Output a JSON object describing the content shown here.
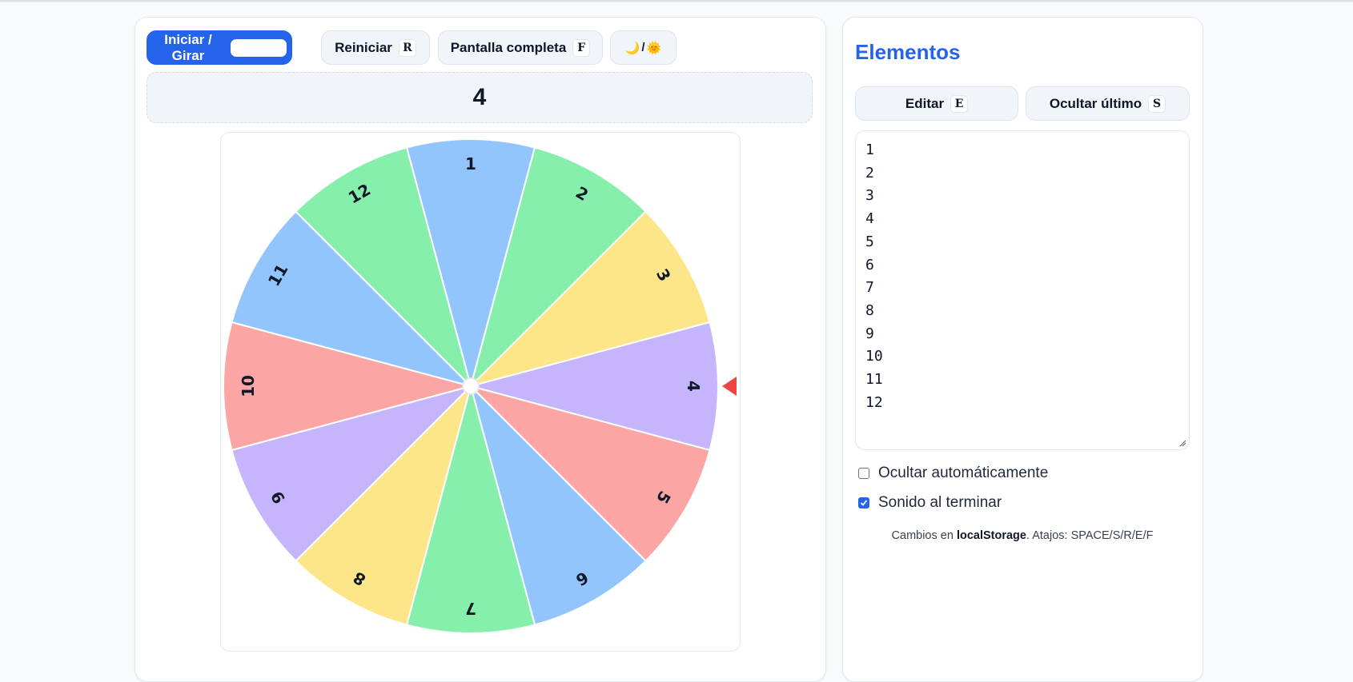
{
  "toolbar": {
    "spin_label": "Iniciar / Girar",
    "reset_label": "Reiniciar",
    "reset_key": "R",
    "fullscreen_label": "Pantalla completa",
    "fullscreen_key": "F",
    "theme_moon": "🌙",
    "theme_sep": "/",
    "theme_sun": "🌞"
  },
  "result": {
    "value": "4"
  },
  "wheel": {
    "segments": [
      {
        "label": "1",
        "color": "#93c5fd"
      },
      {
        "label": "2",
        "color": "#86efac"
      },
      {
        "label": "3",
        "color": "#fde68a"
      },
      {
        "label": "4",
        "color": "#c4b5fd"
      },
      {
        "label": "5",
        "color": "#fca5a5"
      },
      {
        "label": "6",
        "color": "#93c5fd"
      },
      {
        "label": "7",
        "color": "#86efac"
      },
      {
        "label": "8",
        "color": "#fde68a"
      },
      {
        "label": "9",
        "color": "#c4b5fd"
      },
      {
        "label": "10",
        "color": "#fca5a5"
      },
      {
        "label": "11",
        "color": "#93c5fd"
      },
      {
        "label": "12",
        "color": "#86efac"
      }
    ],
    "pointer_color": "#ef4444"
  },
  "panel": {
    "title": "Elementos",
    "edit_label": "Editar",
    "edit_key": "E",
    "hide_last_label": "Ocultar último",
    "hide_last_key": "S",
    "items": [
      "1",
      "2",
      "3",
      "4",
      "5",
      "6",
      "7",
      "8",
      "9",
      "10",
      "11",
      "12"
    ],
    "auto_hide_label": "Ocultar automáticamente",
    "auto_hide_checked": false,
    "sound_label": "Sonido al terminar",
    "sound_checked": true,
    "footnote_prefix": "Cambios en ",
    "footnote_bold": "localStorage",
    "footnote_suffix": ". Atajos: SPACE/S/R/E/F"
  },
  "colors": {
    "accent": "#2563eb"
  }
}
